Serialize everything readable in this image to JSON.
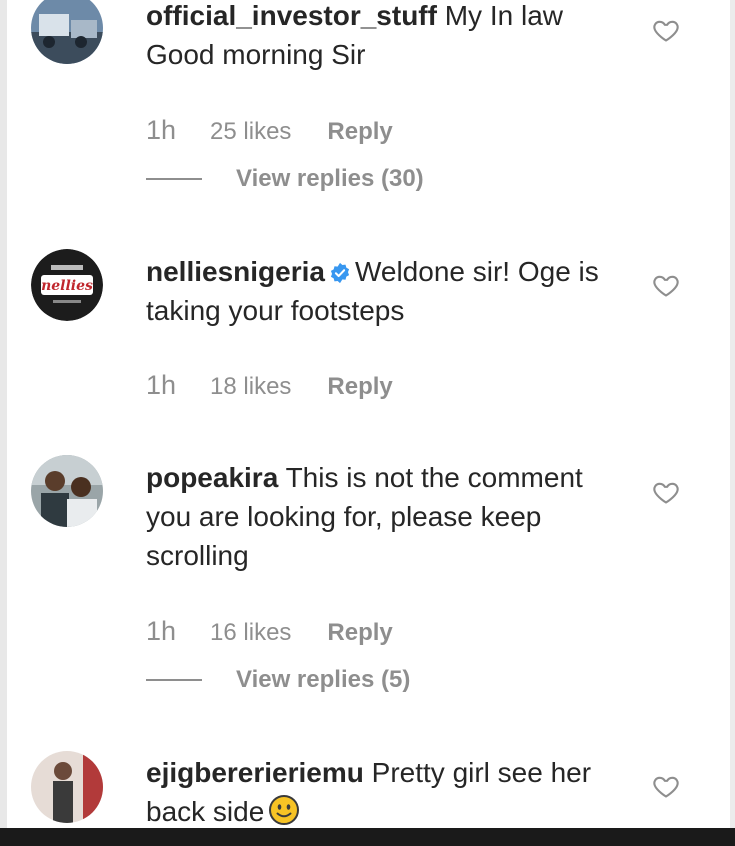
{
  "comments": [
    {
      "username": "official_investor_stuff",
      "text": "My In law Good morning Sir",
      "time": "1h",
      "likes": "25 likes",
      "reply": "Reply",
      "view_replies": "View replies (30)",
      "avatar_icon": "user-avatar-car"
    },
    {
      "username": "nelliesnigeria",
      "verified": true,
      "text": "Weldone sir! Oge is taking your footsteps",
      "time": "1h",
      "likes": "18 likes",
      "reply": "Reply",
      "avatar_icon": "nellies-logo"
    },
    {
      "username": "popeakira",
      "text": "This is not the comment you are looking for, please keep scrolling",
      "time": "1h",
      "likes": "16 likes",
      "reply": "Reply",
      "view_replies": "View replies (5)",
      "avatar_icon": "user-avatar-men"
    },
    {
      "username": "ejigbererieriemu",
      "text": "Pretty girl see her back side",
      "emoji": "slightly-smiling-face",
      "avatar_icon": "user-avatar-person"
    }
  ],
  "colors": {
    "text": "#262626",
    "meta": "#8e8e8e",
    "verified": "#3897f0",
    "emoji": "#f7c325"
  }
}
